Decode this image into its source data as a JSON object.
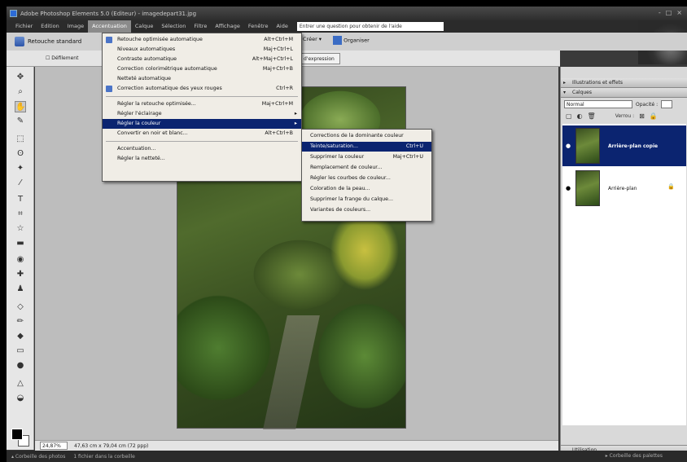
{
  "window": {
    "title": "Adobe Photoshop Elements 5.0 (Editeur) - imagedepart31.jpg",
    "controls": [
      "-",
      "□",
      "×"
    ]
  },
  "menubar": {
    "items": [
      "Fichier",
      "Edition",
      "Image",
      "Accentuation",
      "Calque",
      "Sélection",
      "Filtre",
      "Affichage",
      "Fenêtre",
      "Aide"
    ],
    "active": "Accentuation",
    "help_placeholder": "Entrer une question pour obtenir de l'aide"
  },
  "shortcuts": {
    "retouche": "Retouche standard",
    "creer": "Créer ▾",
    "organiser": "Organiser"
  },
  "options": {
    "defilement": "Défilement",
    "expression_btn": "d'expression"
  },
  "accentuation_menu": {
    "items": [
      {
        "label": "Retouche optimisée automatique",
        "shortcut": "Alt+Ctrl+M"
      },
      {
        "label": "Niveaux automatiques",
        "shortcut": "Maj+Ctrl+L"
      },
      {
        "label": "Contraste automatique",
        "shortcut": "Alt+Maj+Ctrl+L"
      },
      {
        "label": "Correction colorimétrique automatique",
        "shortcut": "Maj+Ctrl+B"
      },
      {
        "label": "Netteté automatique",
        "shortcut": ""
      },
      {
        "label": "Correction automatique des yeux rouges",
        "shortcut": "Ctrl+R"
      },
      {
        "label": "Régler la retouche optimisée...",
        "shortcut": "Maj+Ctrl+M"
      },
      {
        "label": "Régler l'éclairage",
        "shortcut": ""
      },
      {
        "label": "Régler la couleur",
        "shortcut": ""
      },
      {
        "label": "Convertir en noir et blanc...",
        "shortcut": "Alt+Ctrl+B"
      },
      {
        "label": "Accentuation...",
        "shortcut": ""
      },
      {
        "label": "Régler la netteté...",
        "shortcut": ""
      }
    ]
  },
  "couleur_submenu": {
    "items": [
      {
        "label": "Corrections de la dominante couleur",
        "shortcut": ""
      },
      {
        "label": "Teinte/saturation...",
        "shortcut": "Ctrl+U"
      },
      {
        "label": "Supprimer la couleur",
        "shortcut": "Maj+Ctrl+U"
      },
      {
        "label": "Remplacement de couleur...",
        "shortcut": ""
      },
      {
        "label": "Régler les courbes de couleur...",
        "shortcut": ""
      },
      {
        "label": "Coloration de la peau...",
        "shortcut": ""
      },
      {
        "label": "Supprimer la frange du calque...",
        "shortcut": ""
      },
      {
        "label": "Variantes de couleurs...",
        "shortcut": ""
      }
    ]
  },
  "status": {
    "zoom": "24,87%",
    "dimensions": "47,63 cm x 79,04 cm (72 ppp)"
  },
  "palette": {
    "effects_header": "Illustrations et effets",
    "layers_header": "Calques",
    "blend_mode": "Normal",
    "opacity_label": "Opacité :",
    "lock_label": "Verrou :",
    "layers": [
      {
        "name": "Arrière-plan copie"
      },
      {
        "name": "Arrière-plan"
      }
    ],
    "utilisation": "Utilisation"
  },
  "bottombar": {
    "left": "Corbeille des photos",
    "count": "1 fichier dans la corbeille",
    "right": "Corbeille des palettes"
  }
}
